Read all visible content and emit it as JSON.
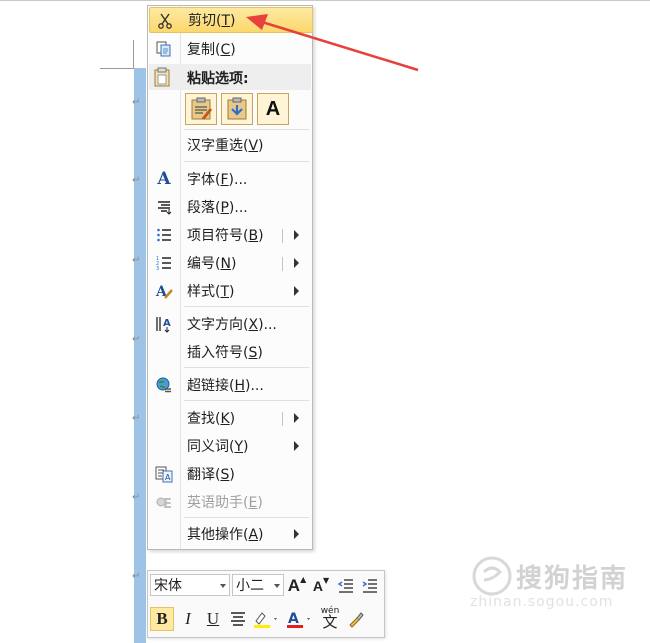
{
  "context_menu": {
    "items": [
      {
        "label": "剪切(T)",
        "text": "剪切(",
        "key": "T",
        "end": ")",
        "icon": "scissors-icon"
      },
      {
        "label": "复制(C)",
        "text": "复制(",
        "key": "C",
        "end": ")",
        "icon": "copy-icon"
      },
      {
        "label": "汉字重选(V)",
        "text": "汉字重选(",
        "key": "V",
        "end": ")"
      },
      {
        "label": "字体(F)...",
        "text": "字体(",
        "key": "F",
        "end": ")...",
        "icon": "font-icon"
      },
      {
        "label": "段落(P)...",
        "text": "段落(",
        "key": "P",
        "end": ")...",
        "icon": "paragraph-icon"
      },
      {
        "label": "项目符号(B)",
        "text": "项目符号(",
        "key": "B",
        "end": ")",
        "icon": "bullets-icon"
      },
      {
        "label": "编号(N)",
        "text": "编号(",
        "key": "N",
        "end": ")",
        "icon": "numbering-icon"
      },
      {
        "label": "样式(T)",
        "text": "样式(",
        "key": "T",
        "end": ")",
        "icon": "styles-icon"
      },
      {
        "label": "文字方向(X)...",
        "text": "文字方向(",
        "key": "X",
        "end": ")...",
        "icon": "text-direction-icon"
      },
      {
        "label": "插入符号(S)",
        "text": "插入符号(",
        "key": "S",
        "end": ")"
      },
      {
        "label": "超链接(H)...",
        "text": "超链接(",
        "key": "H",
        "end": ")...",
        "icon": "hyperlink-icon"
      },
      {
        "label": "查找(K)",
        "text": "查找(",
        "key": "K",
        "end": ")"
      },
      {
        "label": "同义词(Y)",
        "text": "同义词(",
        "key": "Y",
        "end": ")"
      },
      {
        "label": "翻译(S)",
        "text": "翻译(",
        "key": "S",
        "end": ")",
        "icon": "translate-icon"
      },
      {
        "label": "英语助手(E)",
        "text": "英语助手(",
        "key": "E",
        "end": ")",
        "icon": "english-assistant-icon",
        "disabled": true
      },
      {
        "label": "其他操作(A)",
        "text": "其他操作(",
        "key": "A",
        "end": ")"
      }
    ],
    "paste_header": "粘贴选项:",
    "paste_options": [
      "keep-source-formatting-icon",
      "merge-formatting-icon",
      "keep-text-only-icon"
    ],
    "paste_text_only_glyph": "A",
    "highlight_color": "#fbd86c"
  },
  "mini_toolbar": {
    "font_name": "宋体",
    "font_size": "小二",
    "grow_font": "A",
    "shrink_font": "A",
    "bold": "B",
    "italic": "I",
    "underline": "U",
    "font_color_glyph": "A",
    "phonetic_top": "wén",
    "phonetic_bottom": "文",
    "font_color": "#e02020",
    "highlight_color": "#ffee00"
  },
  "watermark": {
    "brand": "搜狗指南",
    "url": "zhinan.sogou.com"
  },
  "annotation": {
    "arrow_color": "#e8413c"
  }
}
